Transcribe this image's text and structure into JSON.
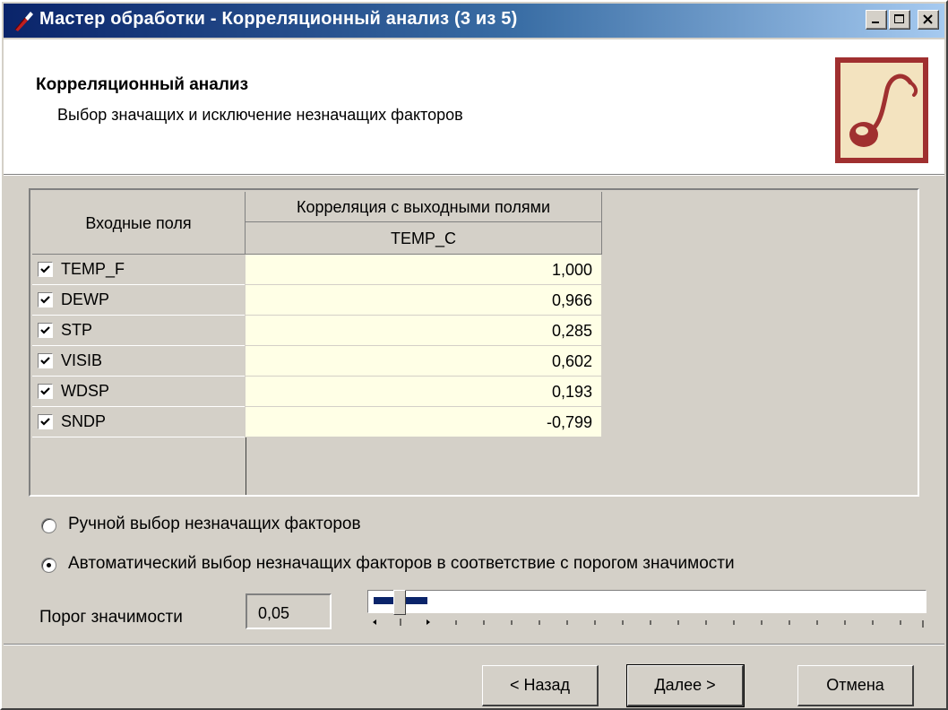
{
  "window": {
    "title": "Мастер обработки - Корреляционный анализ (3 из 5)"
  },
  "header": {
    "title": "Корреляционный анализ",
    "subtitle": "Выбор значащих и исключение незначащих факторов"
  },
  "grid": {
    "col_input_header": "Входные поля",
    "col_corr_header": "Корреляция с выходными полями",
    "col_output_field": "TEMP_C",
    "rows": [
      {
        "name": "TEMP_F",
        "checked": true,
        "value": "1,000"
      },
      {
        "name": "DEWP",
        "checked": true,
        "value": "0,966"
      },
      {
        "name": "STP",
        "checked": true,
        "value": "0,285"
      },
      {
        "name": "VISIB",
        "checked": true,
        "value": "0,602"
      },
      {
        "name": "WDSP",
        "checked": true,
        "value": "0,193"
      },
      {
        "name": "SNDP",
        "checked": true,
        "value": "-0,799"
      }
    ]
  },
  "options": {
    "manual_label": "Ручной выбор незначащих факторов",
    "auto_label": "Автоматический выбор незначащих факторов в соответствие с порогом значимости",
    "selected": "auto"
  },
  "threshold": {
    "label": "Порог значимости",
    "value": "0,05",
    "slider_fraction": 0.05
  },
  "buttons": {
    "back": "< Назад",
    "next": "Далее >",
    "cancel": "Отмена"
  },
  "icons": {
    "app": "wizard-icon",
    "logo": "pipe-logo-icon"
  }
}
